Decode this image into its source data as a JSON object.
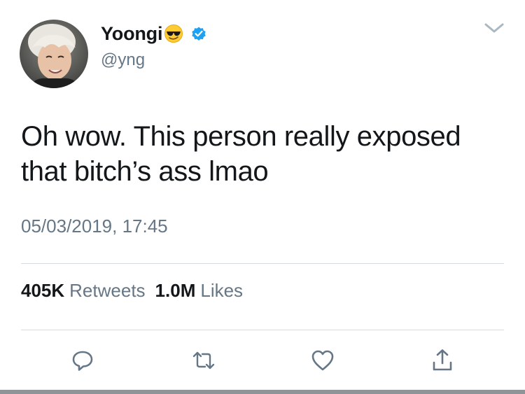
{
  "user": {
    "display_name": "Yoongi",
    "emoji": "sunglasses-emoji",
    "verified_icon": "verified-badge-icon",
    "handle": "@yng",
    "avatar": "profile-avatar"
  },
  "tweet": {
    "text_line1": "Oh wow. This person really exposed",
    "text_line2": "that bitch’s ass lmao",
    "timestamp": "05/03/2019, 17:45"
  },
  "stats": {
    "retweets_count": "405K",
    "retweets_label": "Retweets",
    "likes_count": "1.0M",
    "likes_label": "Likes"
  },
  "actions": {
    "reply_icon": "reply-icon",
    "retweet_icon": "retweet-icon",
    "like_icon": "heart-icon",
    "share_icon": "share-icon",
    "more_icon": "chevron-down-icon"
  },
  "colors": {
    "text_primary": "#14171a",
    "text_secondary": "#657786",
    "verified_blue": "#1da1f2",
    "divider": "#d6dce1"
  }
}
